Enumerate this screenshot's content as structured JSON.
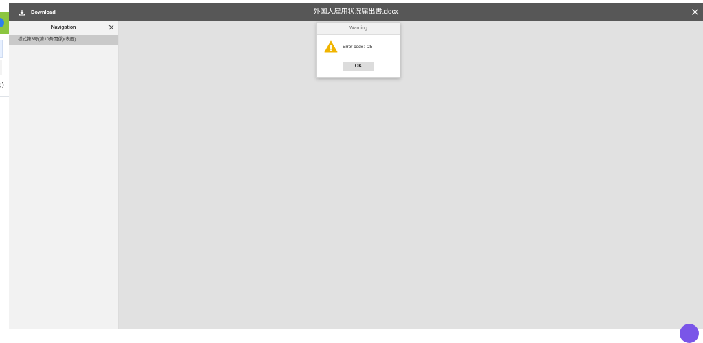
{
  "toolbar": {
    "download_label": "Download",
    "title": "外国人雇用状況届出書.docx"
  },
  "navigation": {
    "header": "Navigation",
    "items": [
      {
        "label": "様式第3号(第10条関係)(表面)"
      }
    ]
  },
  "dialog": {
    "title": "Warning",
    "message": "Error code: -25",
    "ok_label": "OK"
  },
  "background_page": {
    "partial_text": "g)"
  },
  "colors": {
    "toolbar_bg": "#575757",
    "viewer_bg": "#e1e1e1",
    "nav_bg": "#f2f2f2",
    "nav_selected_bg": "#c9c9c9",
    "warning_icon": "#f0b400",
    "chat_bubble": "#7a55e8",
    "accent_green": "#8cc63f"
  },
  "icons": {
    "download": "download-icon",
    "close": "close-icon",
    "warning": "warning-icon",
    "chat": "chat-icon"
  }
}
